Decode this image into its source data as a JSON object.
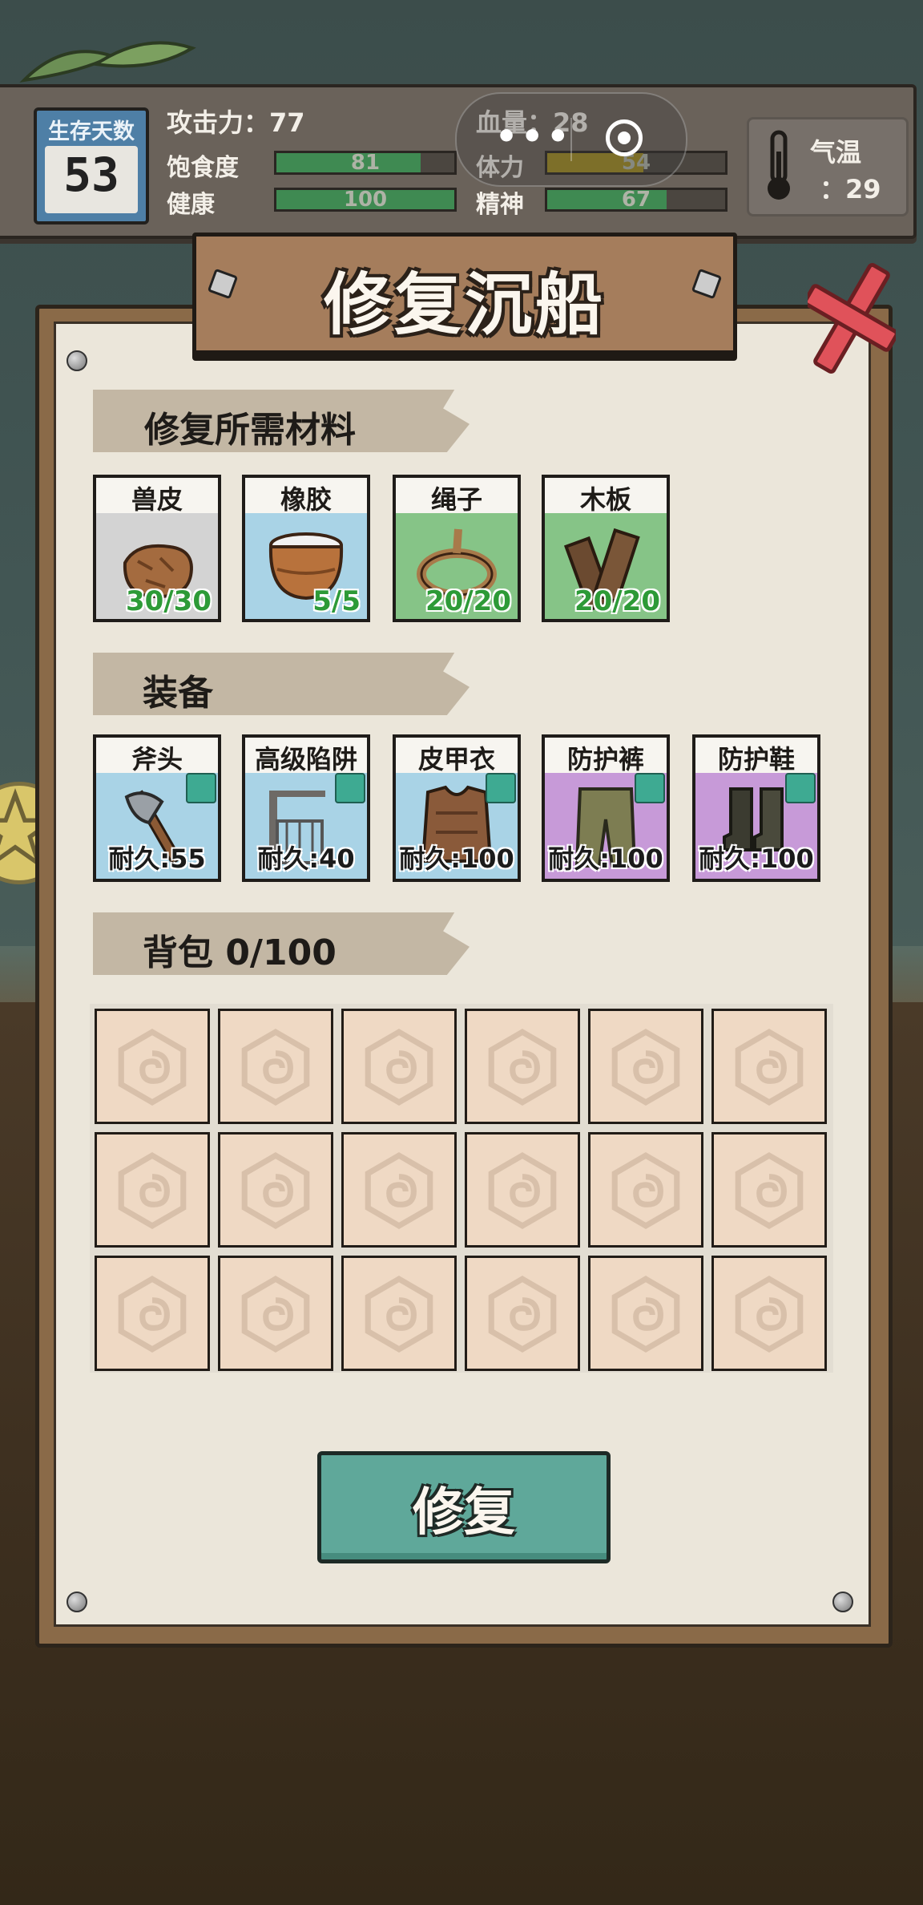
{
  "status": {
    "days_label": "生存天数",
    "days_value": "53",
    "attack": "攻击力：77",
    "hp": "血量：28",
    "temperature_label": "气温",
    "temperature_value": "：29",
    "bars": [
      {
        "label": "饱食度",
        "value": 81,
        "display": "81",
        "color": "#3f8a52"
      },
      {
        "label": "体力",
        "value": 54,
        "display": "54",
        "color": "#a08a20"
      },
      {
        "label": "健康",
        "value": 100,
        "display": "100",
        "color": "#3f8a52"
      },
      {
        "label": "精神",
        "value": 67,
        "display": "67",
        "color": "#3f8a52"
      }
    ]
  },
  "capsule": {
    "more_icon": "more-dots-icon",
    "target_icon": "target-icon"
  },
  "panel": {
    "title": "修复沉船",
    "materials_title": "修复所需材料",
    "equipment_title": "装备",
    "bag_title": "背包 0/100",
    "repair_button": "修复"
  },
  "materials": [
    {
      "name": "兽皮",
      "count": "30/30",
      "icon": "hide-icon",
      "bg": "#d3d3d3"
    },
    {
      "name": "橡胶",
      "count": "5/5",
      "icon": "rubber-pot-icon",
      "bg": "#a9d3e6"
    },
    {
      "name": "绳子",
      "count": "20/20",
      "icon": "rope-icon",
      "bg": "#86c487"
    },
    {
      "name": "木板",
      "count": "20/20",
      "icon": "plank-icon",
      "bg": "#86c487"
    }
  ],
  "equipment": [
    {
      "name": "斧头",
      "durability": "耐久:55",
      "icon": "axe-icon",
      "bg": "#a9d3e6"
    },
    {
      "name": "高级陷阱",
      "durability": "耐久:40",
      "icon": "trap-icon",
      "bg": "#a9d3e6"
    },
    {
      "name": "皮甲衣",
      "durability": "耐久:100",
      "icon": "leather-armor-icon",
      "bg": "#a9d3e6"
    },
    {
      "name": "防护裤",
      "durability": "耐久:100",
      "icon": "pants-icon",
      "bg": "#c79ad8"
    },
    {
      "name": "防护鞋",
      "durability": "耐久:100",
      "icon": "boots-icon",
      "bg": "#c79ad8"
    }
  ],
  "bag": {
    "rows": 3,
    "cols": 6,
    "slot_icon": "swirl-icon"
  }
}
